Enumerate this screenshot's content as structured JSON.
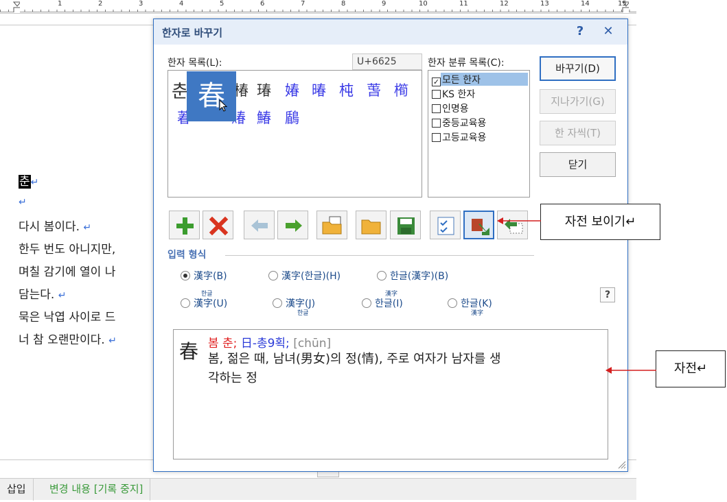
{
  "ruler": {
    "numbers": [
      "1",
      "2",
      "3",
      "4",
      "5",
      "6",
      "7",
      "8",
      "9",
      "10",
      "11",
      "12",
      "13",
      "14",
      "15"
    ]
  },
  "document": {
    "selected_char": "춘",
    "lines": [
      "다시 봄이다.",
      "한두 번도 아니지만,",
      "며칠 감기에 열이 나",
      "담는다.",
      "묵은 낙엽 사이로 드",
      "너 참 오랜만이다."
    ],
    "return_mark": "↵"
  },
  "status_bar": {
    "mode": "삽입",
    "track": "변경 내용 [기록 중지]"
  },
  "dialog": {
    "title": "한자로 바꾸기",
    "help_icon": "?",
    "close_icon": "✕",
    "hanja_list_label": "한자 목록(L):",
    "code_value": "U+6625",
    "category_label": "한자 분류 목록(C):",
    "hanja_row1": [
      "춘",
      "春",
      "椿",
      "瑃",
      "媋",
      "暙",
      "杶",
      "萅",
      "橁"
    ],
    "hanja_row2": [
      "萶",
      "賰",
      "鰆",
      "鶞"
    ],
    "selected_hanja": "春",
    "categories": [
      {
        "label": "모든 한자",
        "checked": true
      },
      {
        "label": "KS 한자",
        "checked": false
      },
      {
        "label": "인명용",
        "checked": false
      },
      {
        "label": "중등교육용",
        "checked": false
      },
      {
        "label": "고등교육용",
        "checked": false
      }
    ],
    "buttons": {
      "replace": "바꾸기(D)",
      "skip": "지나가기(G)",
      "one_by_one": "한 자씩(T)",
      "close": "닫기"
    },
    "input_format_title": "입력 형식",
    "radios": [
      {
        "label": "漢字(B)",
        "checked": true
      },
      {
        "label": "漢字(한글)(H)",
        "checked": false
      },
      {
        "label": "한글(漢字)(B)",
        "checked": false
      },
      {
        "label": "漢字(U)",
        "ruby": "한글",
        "checked": false
      },
      {
        "label": "漢字(J)",
        "ruby": "한글",
        "checked": false
      },
      {
        "label": "한글(I)",
        "ruby": "漢字",
        "checked": false
      },
      {
        "label": "한글(K)",
        "ruby": "漢字",
        "checked": false
      }
    ],
    "format_help": "?",
    "dictionary": {
      "char": "春",
      "reading": "봄 춘;",
      "radical": "日-총9획;",
      "pinyin": "[chūn]",
      "meaning_line1": "봄, 젊은 때, 남녀(男女)의 정(情), 주로 여자가 남자를 생",
      "meaning_line2": "각하는 정"
    }
  },
  "callouts": {
    "dictionary_view": "자전 보이기↵",
    "dictionary": "자전↵"
  },
  "colors": {
    "accent": "#2e6ec2",
    "hanja": "#3a3ae6",
    "reading": "#e02020",
    "callout_arrow": "#d41f1f"
  }
}
